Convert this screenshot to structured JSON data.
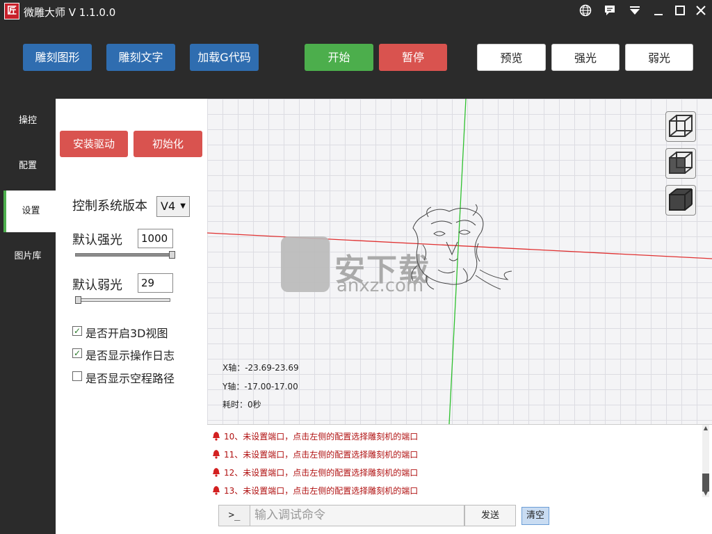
{
  "title_bar": {
    "logo": "匠",
    "app_title": "微雕大师 V 1.1.0.0"
  },
  "toolbar": {
    "engrave_shape": "雕刻图形",
    "engrave_text": "雕刻文字",
    "load_gcode": "加载G代码",
    "start": "开始",
    "pause": "暂停",
    "preview": "预览",
    "strong_light": "强光",
    "weak_light": "弱光"
  },
  "nav": {
    "items": [
      {
        "label": "操控"
      },
      {
        "label": "配置"
      },
      {
        "label": "设置"
      },
      {
        "label": "图片库"
      }
    ],
    "active": "设置"
  },
  "settings": {
    "install_driver": "安装驱动",
    "initialize": "初始化",
    "control_version_label": "控制系统版本",
    "control_version_value": "V4",
    "default_strong_label": "默认强光",
    "default_strong_value": "1000",
    "default_strong_level": 1.0,
    "default_weak_label": "默认弱光",
    "default_weak_value": "29",
    "default_weak_level": 0.029,
    "options": [
      {
        "label": "是否开启3D视图",
        "checked": true
      },
      {
        "label": "是否显示操作日志",
        "checked": true
      },
      {
        "label": "是否显示空程路径",
        "checked": false
      }
    ]
  },
  "viewport": {
    "x_axis": "X轴：-23.69-23.69",
    "y_axis": "Y轴：-17.00-17.00",
    "elapsed": "耗时：0秒",
    "watermark_text": "安下载",
    "watermark_sub": "anxz.com",
    "axis_x_color": "#e03030",
    "axis_y_color": "#2ec02e"
  },
  "log": {
    "entries": [
      "10、未设置端口，点击左侧的配置选择雕刻机的端口",
      "11、未设置端口，点击左侧的配置选择雕刻机的端口",
      "12、未设置端口，点击左侧的配置选择雕刻机的端口",
      "13、未设置端口，点击左侧的配置选择雕刻机的端口"
    ]
  },
  "command": {
    "prompt": ">_",
    "placeholder": "输入调试命令",
    "send": "发送",
    "clear": "清空"
  },
  "icons": {
    "globe": "globe-icon",
    "message": "message-icon",
    "dropdown": "dropdown-icon",
    "minimize": "minimize-icon",
    "maximize": "maximize-icon",
    "close": "close-icon",
    "bell": "bell-icon"
  }
}
